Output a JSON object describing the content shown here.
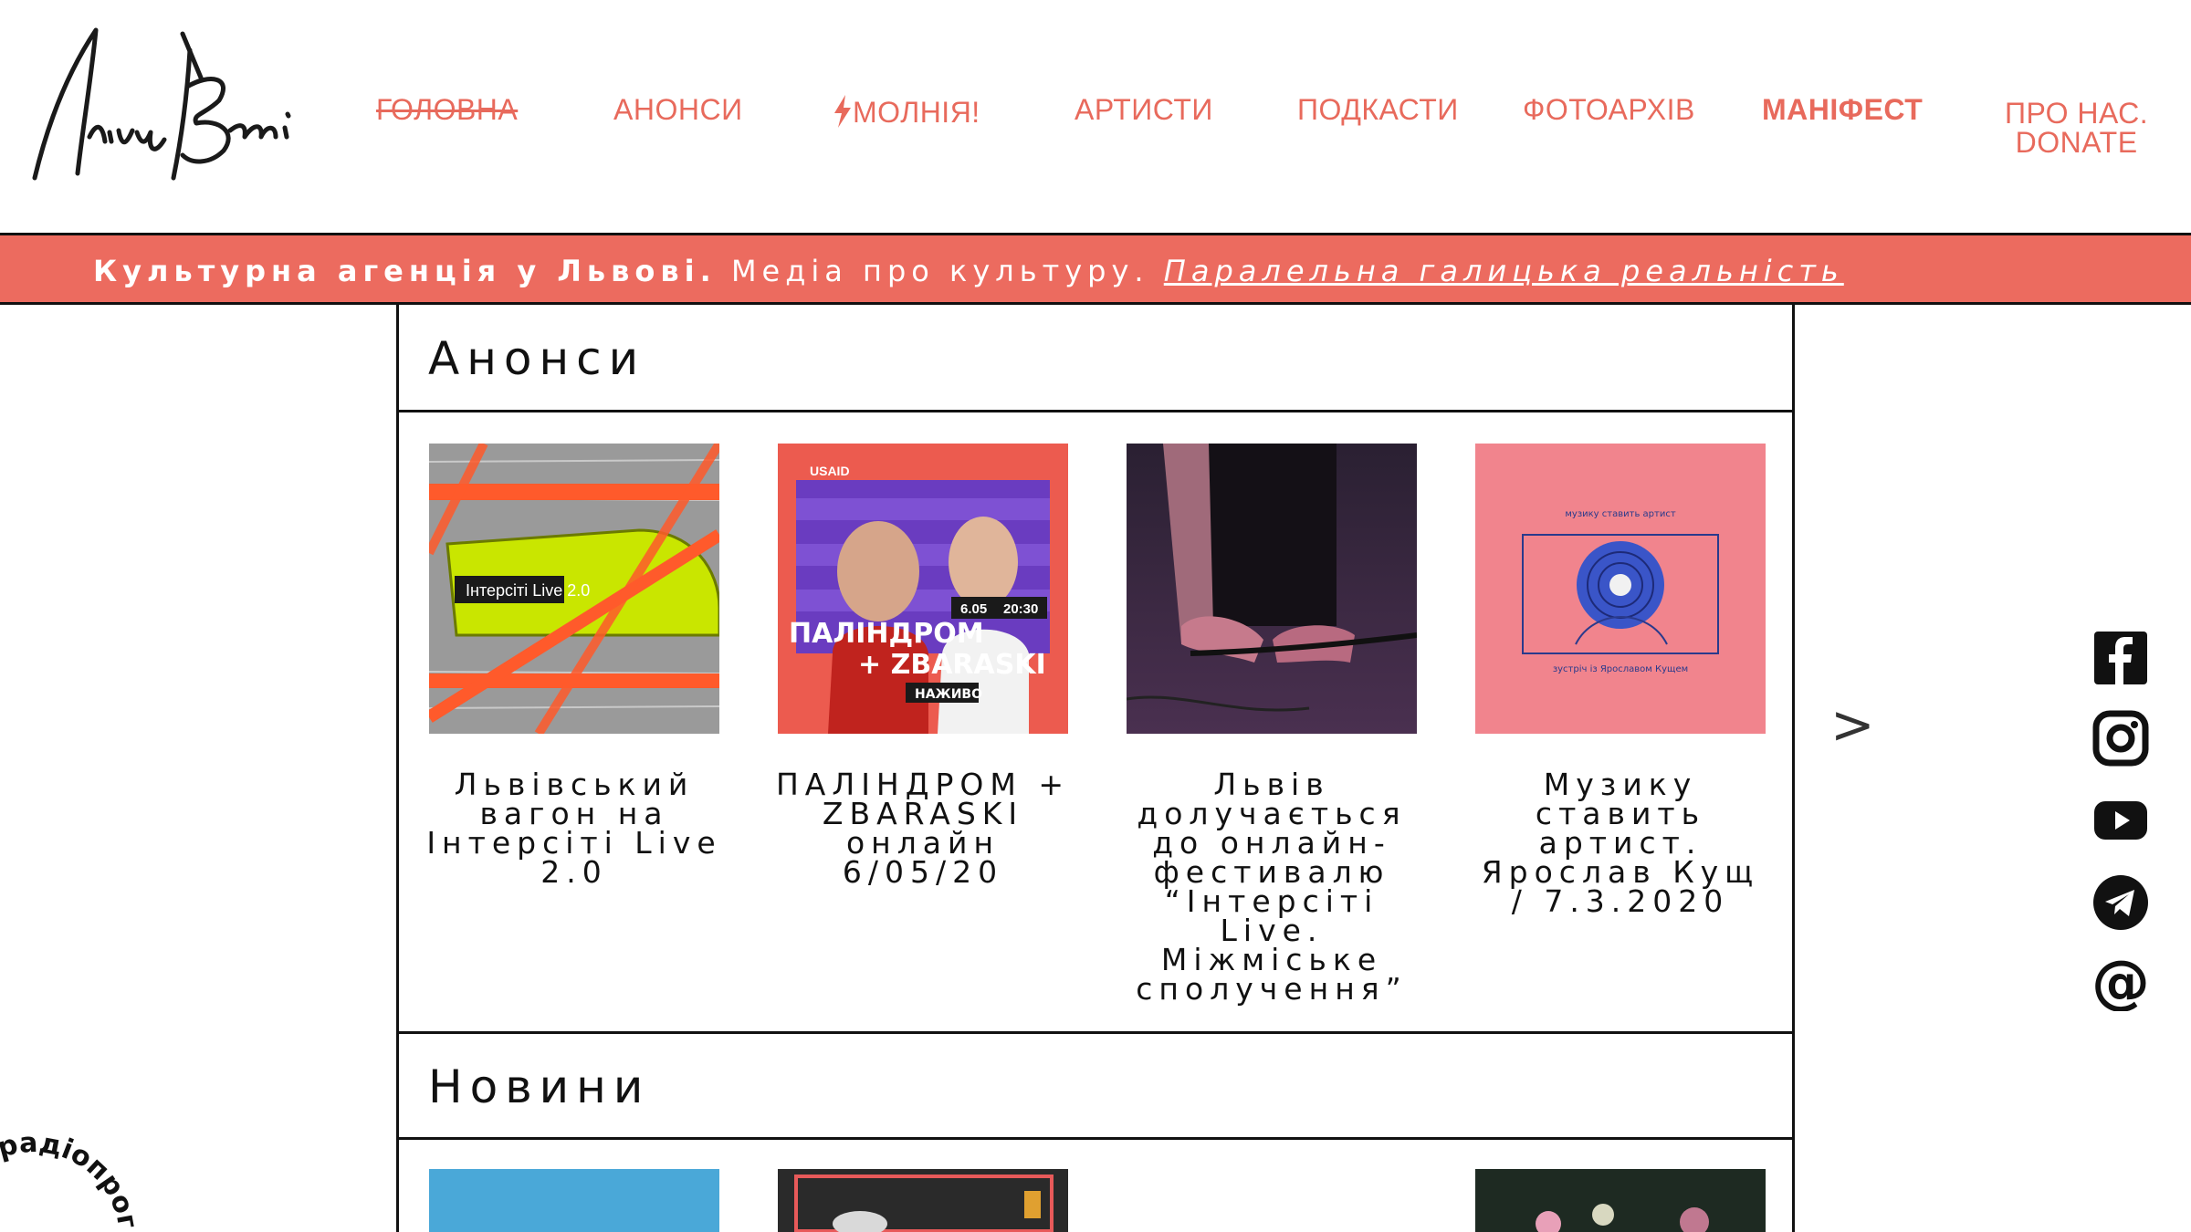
{
  "header": {
    "logo_alt": "Лінія Времі",
    "nav": [
      {
        "label": "ГОЛОВНА",
        "state": "active"
      },
      {
        "label": "АНОНСИ"
      },
      {
        "label": "МОЛНІЯ!",
        "icon": "lightning-icon"
      },
      {
        "label": "АРТИСТИ"
      },
      {
        "label": "ПОДКАСТИ"
      },
      {
        "label": "ФОТОАРХІВ"
      },
      {
        "label": "МАНІФЕСТ",
        "weight": "bold"
      },
      {
        "label_line1": "ПРО НАС.",
        "label_line2": "DONATE"
      }
    ]
  },
  "banner": {
    "part1": "Культурна агенція у Львові.",
    "part2": " Медіа про культуру. ",
    "part3": "Паралельна галицька реальність"
  },
  "sections": {
    "announcements": {
      "title": "Анонси",
      "cards": [
        {
          "title": "Львівський вагон на Інтерсіті Live 2.0",
          "image_text": "Інтерсіті Live 2.0"
        },
        {
          "title": "ПАЛІНДРОМ + ZBARASKI онлайн 6/05/20",
          "image_text_1": "ПАЛІНДРОМ",
          "image_text_2": "+ ZBARASKI",
          "image_text_3": "НАЖИВО",
          "image_date": "6.05",
          "image_time": "20:30",
          "image_brand": "USAID"
        },
        {
          "title": "Львів долучається до онлайн-фестивалю “Інтерсіті Live. Міжміське сполучення”"
        },
        {
          "title": "Музику ставить артист. Ярослав Кущ / 7.3.2020",
          "image_text_1": "музику ставить артист",
          "image_text_2": "зустріч із Ярославом Кущем"
        }
      ],
      "next_label": ">"
    },
    "news": {
      "title": "Новини"
    }
  },
  "social": [
    "facebook-icon",
    "instagram-icon",
    "youtube-icon",
    "telegram-icon",
    "email-icon"
  ],
  "badge_text": ", радіопрог",
  "colors": {
    "accent": "#ec6b5f",
    "nav_text": "#e86a5c",
    "border": "#111111"
  }
}
